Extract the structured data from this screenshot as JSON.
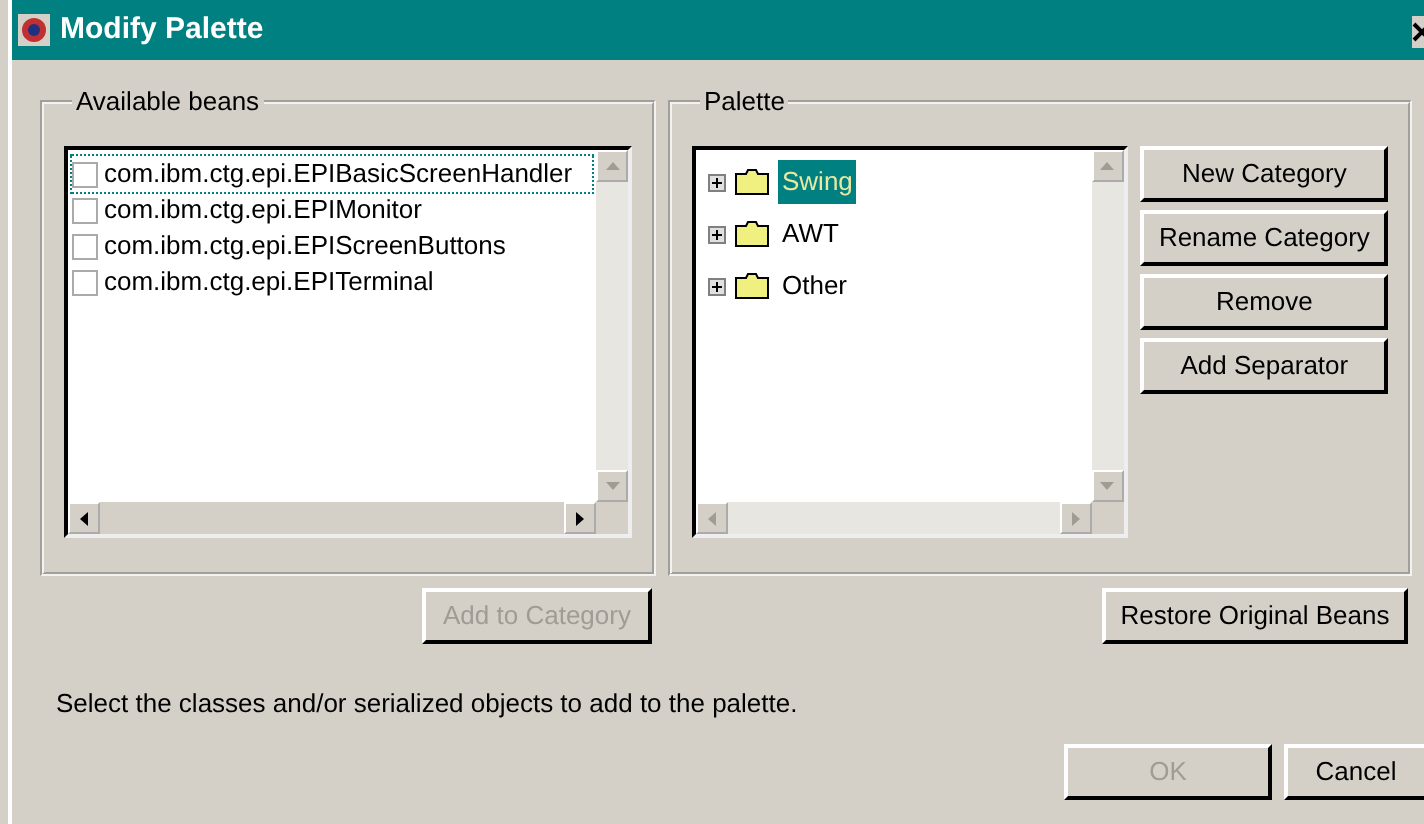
{
  "window": {
    "title": "Modify Palette"
  },
  "available_beans": {
    "title": "Available beans",
    "items": [
      {
        "label": "com.ibm.ctg.epi.EPIBasicScreenHandler",
        "checked": false,
        "focused": true
      },
      {
        "label": "com.ibm.ctg.epi.EPIMonitor",
        "checked": false,
        "focused": false
      },
      {
        "label": "com.ibm.ctg.epi.EPIScreenButtons",
        "checked": false,
        "focused": false
      },
      {
        "label": "com.ibm.ctg.epi.EPITerminal",
        "checked": false,
        "focused": false
      }
    ]
  },
  "palette": {
    "title": "Palette",
    "categories": [
      {
        "label": "Swing",
        "selected": true,
        "expanded": false
      },
      {
        "label": "AWT",
        "selected": false,
        "expanded": false
      },
      {
        "label": "Other",
        "selected": false,
        "expanded": false
      }
    ],
    "buttons": [
      {
        "label": "New Category",
        "disabled": false
      },
      {
        "label": "Rename Category",
        "disabled": false
      },
      {
        "label": "Remove",
        "disabled": false
      },
      {
        "label": "Add Separator",
        "disabled": false
      }
    ]
  },
  "add_to_category": {
    "label": "Add to Category",
    "disabled": true
  },
  "restore_button": {
    "label": "Restore Original Beans",
    "disabled": false
  },
  "message": "Select the classes and/or serialized objects to add to the palette.",
  "dialog_buttons": [
    {
      "label": "OK",
      "disabled": true
    },
    {
      "label": "Cancel",
      "disabled": false
    }
  ]
}
